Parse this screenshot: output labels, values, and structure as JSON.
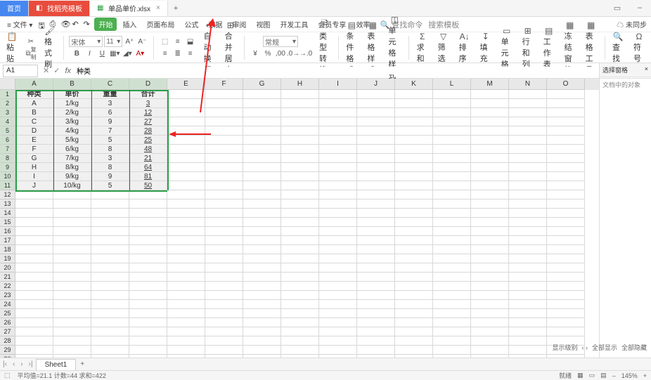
{
  "title_tabs": {
    "home": "首页",
    "pdf": "找稻壳模板",
    "file": "单品单价.xlsx"
  },
  "menu": [
    "文件",
    "开始",
    "插入",
    "页面布局",
    "公式",
    "数据",
    "审阅",
    "视图",
    "开发工具",
    "会员专享",
    "效率"
  ],
  "menu_search": "查找命令",
  "menu_tpl": "搜索模板",
  "menu_unsync": "未同步",
  "quick": {
    "save": "保存",
    "undo": "撤销",
    "redo": "重做"
  },
  "ribbon": {
    "paste": "粘贴",
    "cut": "剪切",
    "copy": "复制",
    "format_painter": "格式刷",
    "font_name": "宋体",
    "font_size": "11",
    "bold": "B",
    "italic": "I",
    "underline": "U",
    "wrap": "自动换行",
    "merge": "合并居中",
    "general": "常规",
    "cond": "条件格式",
    "table_style": "表格样式",
    "cell_style": "单元格样式",
    "sum": "求和",
    "filter": "筛选",
    "sort": "排序",
    "fill": "填充",
    "cell": "单元格",
    "row_col": "行和列",
    "sheet": "工作表",
    "freeze": "冻结窗格",
    "table": "表格工具",
    "find": "查找",
    "symbol": "符号"
  },
  "name_box": "A1",
  "fx": "fx",
  "formula_value": "种类",
  "columns": [
    "A",
    "B",
    "C",
    "D",
    "E",
    "F",
    "G",
    "H",
    "I",
    "J",
    "K",
    "L",
    "M",
    "N",
    "O"
  ],
  "table_headers": [
    "种类",
    "单价",
    "重量",
    "合计"
  ],
  "table_rows": [
    {
      "k": "A",
      "p": "1/kg",
      "w": "3",
      "t": "3"
    },
    {
      "k": "B",
      "p": "2/kg",
      "w": "6",
      "t": "12"
    },
    {
      "k": "C",
      "p": "3/kg",
      "w": "9",
      "t": "27"
    },
    {
      "k": "D",
      "p": "4/kg",
      "w": "7",
      "t": "28"
    },
    {
      "k": "E",
      "p": "5/kg",
      "w": "5",
      "t": "25"
    },
    {
      "k": "F",
      "p": "6/kg",
      "w": "8",
      "t": "48"
    },
    {
      "k": "G",
      "p": "7/kg",
      "w": "3",
      "t": "21"
    },
    {
      "k": "H",
      "p": "8/kg",
      "w": "8",
      "t": "64"
    },
    {
      "k": "I",
      "p": "9/kg",
      "w": "9",
      "t": "81"
    },
    {
      "k": "J",
      "p": "10/kg",
      "w": "5",
      "t": "50"
    }
  ],
  "row_count": 30,
  "sheet_tab": "Sheet1",
  "side_panel": {
    "title": "选择窗格",
    "hint": "文档中的对象"
  },
  "side_float": {
    "lvl": "显示级别",
    "all": "全部显示",
    "hide": "全部隐藏"
  },
  "status": {
    "stats": "平均值=21.1  计数=44  求和=422",
    "mode": "就绪",
    "zoom": "145%"
  }
}
